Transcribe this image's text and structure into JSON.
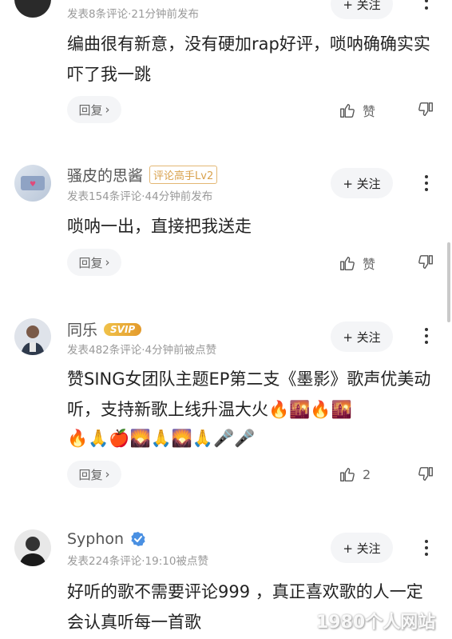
{
  "comments": [
    {
      "meta": "发表8条评论·21分钟前发布",
      "follow_label": "+ 关注",
      "text": "编曲很有新意，没有硬加rap好评，唢呐确确实实吓了我一跳",
      "reply_label": "回复",
      "like_label": "赞"
    },
    {
      "username": "骚皮的思酱",
      "badge": "评论高手Lv2",
      "meta": "发表154条评论·44分钟前发布",
      "follow_label": "+ 关注",
      "text": "唢呐一出，直接把我送走",
      "reply_label": "回复",
      "like_label": "赞"
    },
    {
      "username": "同乐",
      "badge": "SVIP",
      "meta": "发表482条评论·4分钟前被点赞",
      "follow_label": "+ 关注",
      "text": "赞SING女团队主题EP第二支《墨影》歌声优美动听，支持新歌上线升温大火🔥🌇🔥🌇",
      "emoji_line": "🔥🙏🍎🌄🙏🌄🙏🎤🎤",
      "reply_label": "回复",
      "like_count": "2"
    },
    {
      "username": "Syphon",
      "meta": "发表224条评论·19:10被点赞",
      "follow_label": "+ 关注",
      "text": "好听的歌不需要评论999 ，真正喜欢歌的人一定会认真听每一首歌"
    }
  ],
  "watermark": "1980个人网站",
  "colors": {
    "badge_gold": "#e3b774",
    "svip_gold": "#e39a2c",
    "verified_blue": "#4a90e2",
    "pill_bg": "#f4f5f7"
  }
}
